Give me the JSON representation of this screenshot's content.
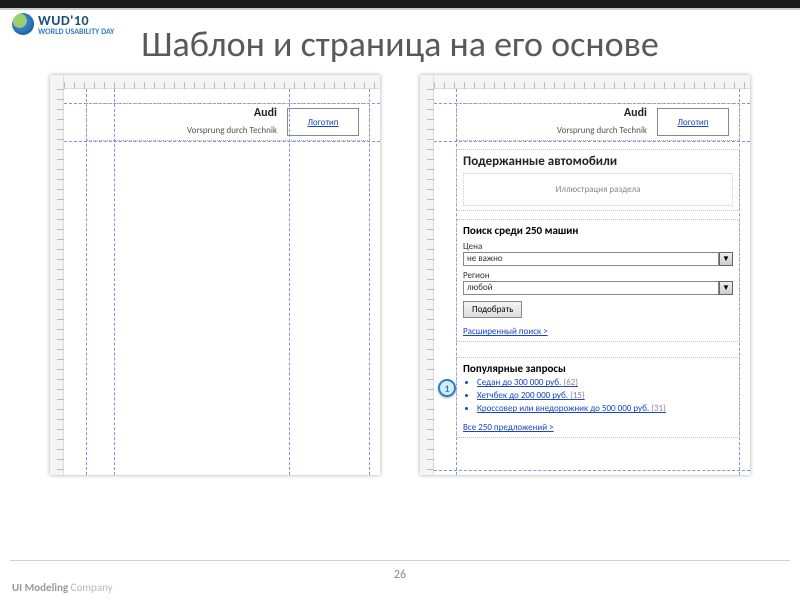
{
  "event": {
    "logo_text": "WUD'10",
    "logo_sub": "WORLD USABILITY DAY"
  },
  "slide": {
    "title": "Шаблон и страница на его основе",
    "number": "26"
  },
  "footer_brand": {
    "a": "UI Modeling",
    "b": " Company"
  },
  "template": {
    "brand_name": "Audi",
    "brand_tagline": "Vorsprung durch Technik",
    "logo_placeholder": "Логотип"
  },
  "page": {
    "brand_name": "Audi",
    "brand_tagline": "Vorsprung durch Technik",
    "logo_placeholder": "Логотип",
    "h2": "Подержанные автомобили",
    "illustration_label": "Иллюстрация раздела",
    "search": {
      "heading": "Поиск среди 250 машин",
      "price_label": "Цена",
      "price_value": "не важно",
      "region_label": "Регион",
      "region_value": "любой",
      "submit": "Подобрать",
      "advanced": "Расширенный поиск >"
    },
    "popular": {
      "heading": "Популярные запросы",
      "items": [
        {
          "label": "Седан до 300 000 руб.",
          "count": "(62)"
        },
        {
          "label": "Хетчбек до 200 000 руб.",
          "count": "(15)"
        },
        {
          "label": "Кроссовер или внедорожник до 500 000 руб.",
          "count": "(31)"
        }
      ],
      "all": "Все 250 предложений >"
    },
    "annotation_pin": "1"
  }
}
